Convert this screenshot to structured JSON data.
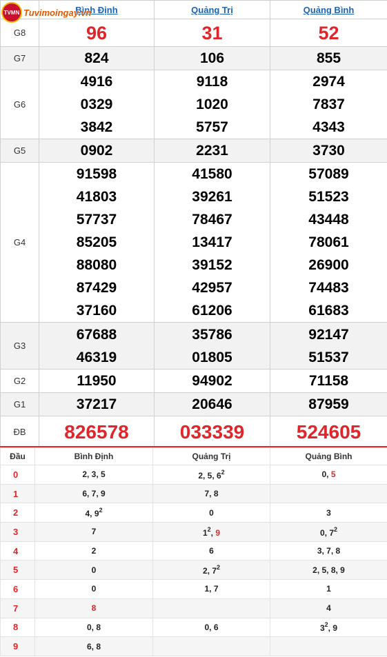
{
  "logo": {
    "badge": "TVMN",
    "text": "Tuvimoingay.vn"
  },
  "columns": [
    "Bình Định",
    "Quảng Trị",
    "Quảng Bình"
  ],
  "prizes": [
    {
      "label": "G8",
      "values": [
        [
          "96"
        ],
        [
          "31"
        ],
        [
          "52"
        ]
      ]
    },
    {
      "label": "G7",
      "values": [
        [
          "824"
        ],
        [
          "106"
        ],
        [
          "855"
        ]
      ]
    },
    {
      "label": "G6",
      "values": [
        [
          "4916",
          "0329",
          "3842"
        ],
        [
          "9118",
          "1020",
          "5757"
        ],
        [
          "2974",
          "7837",
          "4343"
        ]
      ]
    },
    {
      "label": "G5",
      "values": [
        [
          "0902"
        ],
        [
          "2231"
        ],
        [
          "3730"
        ]
      ]
    },
    {
      "label": "G4",
      "values": [
        [
          "91598",
          "41803",
          "57737",
          "85205",
          "88080",
          "87429",
          "37160"
        ],
        [
          "41580",
          "39261",
          "78467",
          "13417",
          "39152",
          "42957",
          "61206"
        ],
        [
          "57089",
          "51523",
          "43448",
          "78061",
          "26900",
          "74483",
          "61683"
        ]
      ]
    },
    {
      "label": "G3",
      "values": [
        [
          "67688",
          "46319"
        ],
        [
          "35786",
          "01805"
        ],
        [
          "92147",
          "51537"
        ]
      ]
    },
    {
      "label": "G2",
      "values": [
        [
          "11950"
        ],
        [
          "94902"
        ],
        [
          "71158"
        ]
      ]
    },
    {
      "label": "G1",
      "values": [
        [
          "37217"
        ],
        [
          "20646"
        ],
        [
          "87959"
        ]
      ]
    },
    {
      "label": "ĐB",
      "values": [
        [
          "826578"
        ],
        [
          "033339"
        ],
        [
          "524605"
        ]
      ]
    }
  ],
  "loto": {
    "header": "Đầu",
    "rows": [
      {
        "head": "0",
        "cells": [
          [
            {
              "t": "2, 3, 5"
            }
          ],
          [
            {
              "t": "2, 5, 6"
            },
            {
              "t": "2",
              "sup": true
            }
          ],
          [
            {
              "t": "0, "
            },
            {
              "t": "5",
              "red": true
            }
          ]
        ]
      },
      {
        "head": "1",
        "cells": [
          [
            {
              "t": "6, 7, 9"
            }
          ],
          [
            {
              "t": "7, 8"
            }
          ],
          []
        ]
      },
      {
        "head": "2",
        "cells": [
          [
            {
              "t": "4, 9"
            },
            {
              "t": "2",
              "sup": true
            }
          ],
          [
            {
              "t": "0"
            }
          ],
          [
            {
              "t": "3"
            }
          ]
        ]
      },
      {
        "head": "3",
        "cells": [
          [
            {
              "t": "7"
            }
          ],
          [
            {
              "t": "1"
            },
            {
              "t": "2",
              "sup": true
            },
            {
              "t": ", "
            },
            {
              "t": "9",
              "red": true
            }
          ],
          [
            {
              "t": "0, 7"
            },
            {
              "t": "2",
              "sup": true
            }
          ]
        ]
      },
      {
        "head": "4",
        "cells": [
          [
            {
              "t": "2"
            }
          ],
          [
            {
              "t": "6"
            }
          ],
          [
            {
              "t": "3, 7, 8"
            }
          ]
        ]
      },
      {
        "head": "5",
        "cells": [
          [
            {
              "t": "0"
            }
          ],
          [
            {
              "t": "2, 7"
            },
            {
              "t": "2",
              "sup": true
            }
          ],
          [
            {
              "t": "2, 5, 8, 9"
            }
          ]
        ]
      },
      {
        "head": "6",
        "cells": [
          [
            {
              "t": "0"
            }
          ],
          [
            {
              "t": "1, 7"
            }
          ],
          [
            {
              "t": "1"
            }
          ]
        ]
      },
      {
        "head": "7",
        "cells": [
          [
            {
              "t": "8",
              "red": true
            }
          ],
          [],
          [
            {
              "t": "4"
            }
          ]
        ]
      },
      {
        "head": "8",
        "cells": [
          [
            {
              "t": "0, 8"
            }
          ],
          [
            {
              "t": "0, 6"
            }
          ],
          [
            {
              "t": "3"
            },
            {
              "t": "2",
              "sup": true
            },
            {
              "t": ", 9"
            }
          ]
        ]
      },
      {
        "head": "9",
        "cells": [
          [
            {
              "t": "6, 8"
            }
          ],
          [],
          []
        ]
      }
    ]
  },
  "colors": {
    "accent": "#e0262a",
    "link": "#1b64b5",
    "stripe": "#f2f2f2"
  }
}
